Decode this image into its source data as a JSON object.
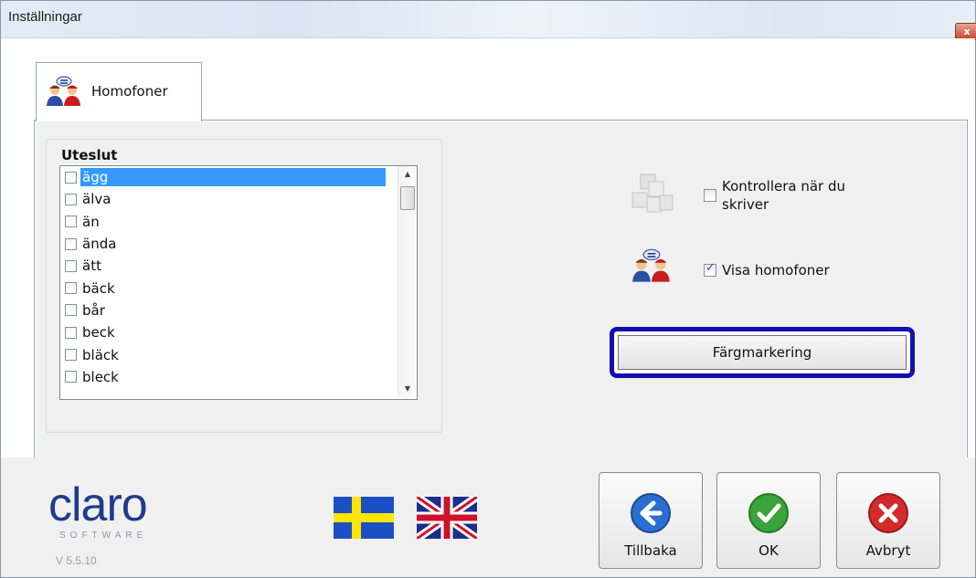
{
  "window": {
    "title": "Inställningar",
    "close_glyph": "x"
  },
  "tabs": [
    {
      "label": "Homofoner",
      "icon": "people-icon"
    }
  ],
  "exclude_group": {
    "label": "Uteslut",
    "items": [
      {
        "text": "ägg",
        "checked": false,
        "selected": true
      },
      {
        "text": "älva",
        "checked": false,
        "selected": false
      },
      {
        "text": "än",
        "checked": false,
        "selected": false
      },
      {
        "text": "ända",
        "checked": false,
        "selected": false
      },
      {
        "text": "ätt",
        "checked": false,
        "selected": false
      },
      {
        "text": "bäck",
        "checked": false,
        "selected": false
      },
      {
        "text": "bår",
        "checked": false,
        "selected": false
      },
      {
        "text": "beck",
        "checked": false,
        "selected": false
      },
      {
        "text": "bläck",
        "checked": false,
        "selected": false
      },
      {
        "text": "bleck",
        "checked": false,
        "selected": false
      }
    ]
  },
  "options": {
    "check_while_typing": {
      "label_line1": "Kontrollera när du",
      "label_line2": "skriver",
      "checked": false,
      "icon": "cubes-icon"
    },
    "show_homophones": {
      "label": "Visa homofoner",
      "checked": true,
      "icon": "people-icon"
    }
  },
  "color_button": {
    "label": "Färgmarkering",
    "accent": "#1010b0"
  },
  "footer": {
    "logo_main": "claro",
    "logo_sub": "SOFTWARE",
    "version": "V 5.5.10",
    "flags": [
      "swedish-flag",
      "uk-flag"
    ],
    "buttons": {
      "back": {
        "label": "Tillbaka",
        "color": "#2a6fd0"
      },
      "ok": {
        "label": "OK",
        "color": "#3aa33a"
      },
      "cancel": {
        "label": "Avbryt",
        "color": "#d32a2a"
      }
    }
  }
}
